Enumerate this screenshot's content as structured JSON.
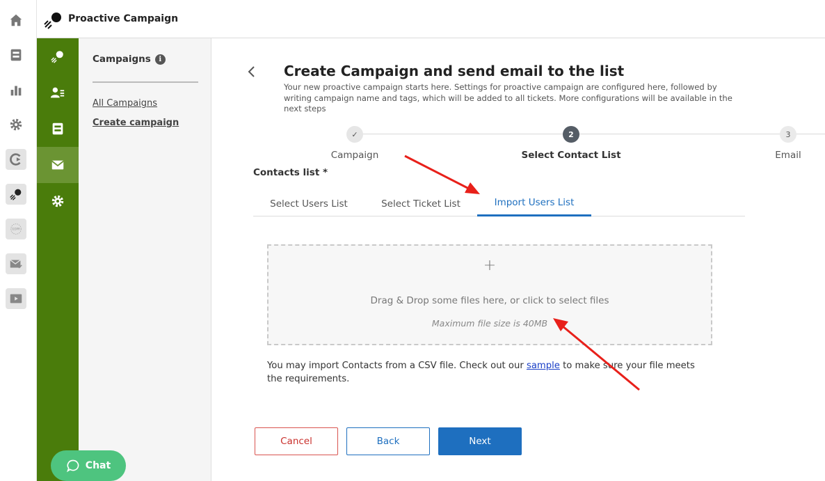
{
  "header": {
    "title": "Proactive Campaign",
    "logo_icon": "proactive-campaign-logo"
  },
  "rail_icons": [
    "home-icon",
    "inbox-icon",
    "bar-chart-icon",
    "gear-icon",
    "refresh-icon",
    "proactive-icon",
    "gdpr-icon",
    "mail-check-icon",
    "play-icon"
  ],
  "gdpr_label": "GDPR",
  "module_icons": [
    "proactive-icon",
    "contacts-icon",
    "inbox-icon",
    "mail-icon",
    "gear-icon"
  ],
  "subnav": {
    "title": "Campaigns",
    "info": "i",
    "links": [
      "All Campaigns",
      "Create campaign"
    ]
  },
  "main": {
    "title": "Create Campaign and send email to the list",
    "description": "Your new proactive campaign starts here. Settings for proactive campaign are configured here, followed by writing campaign name and tags, which will be added to all tickets. More configurations will be available in the next steps"
  },
  "steps": [
    {
      "label": "Campaign",
      "marker": "✓",
      "state": "done"
    },
    {
      "label": "Select Contact List",
      "marker": "2",
      "state": "current"
    },
    {
      "label": "Email",
      "marker": "3",
      "state": "upcoming"
    }
  ],
  "contacts_label": "Contacts list *",
  "tabs": [
    "Select Users List",
    "Select Ticket List",
    "Import Users List"
  ],
  "active_tab": "Import Users List",
  "dropzone": {
    "plus": "+",
    "text": "Drag & Drop some files here, or click to select files",
    "max_size": "Maximum file size is 40MB"
  },
  "import_note": {
    "before": "You may import Contacts from a CSV file. Check out our ",
    "link": "sample",
    "after": " to make sure your file meets the requirements."
  },
  "buttons": {
    "cancel": "Cancel",
    "back": "Back",
    "next": "Next"
  },
  "chat": {
    "label": "Chat"
  },
  "colors": {
    "sidebar_green": "#4a7c0b",
    "active_green": "#6b9433",
    "accent_blue": "#1e6fbf",
    "cancel_red": "#c9302c",
    "chat_green": "#4ec47f",
    "annotation_red": "#e8201a"
  }
}
